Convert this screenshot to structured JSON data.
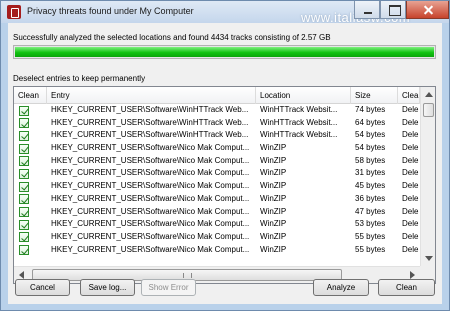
{
  "window": {
    "title": "Privacy threats found under My Computer",
    "watermark": "www.italiasw.com"
  },
  "summary": "Successfully analyzed the selected locations and found 4434 tracks consisting of 2.57 GB",
  "progress": {
    "value": 1.0,
    "color": "#12c312"
  },
  "deselect_label": "Deselect entries to keep permanently",
  "table": {
    "columns": [
      "Clean",
      "Entry",
      "Location",
      "Size",
      "Clea"
    ],
    "rows": [
      {
        "checked": true,
        "entry": "HKEY_CURRENT_USER\\Software\\WinHTTrack Web...",
        "location": "WinHTTrack Websit...",
        "size": "74 bytes",
        "action": "Dele"
      },
      {
        "checked": true,
        "entry": "HKEY_CURRENT_USER\\Software\\WinHTTrack Web...",
        "location": "WinHTTrack Websit...",
        "size": "64 bytes",
        "action": "Dele"
      },
      {
        "checked": true,
        "entry": "HKEY_CURRENT_USER\\Software\\WinHTTrack Web...",
        "location": "WinHTTrack Websit...",
        "size": "54 bytes",
        "action": "Dele"
      },
      {
        "checked": true,
        "entry": "HKEY_CURRENT_USER\\Software\\Nico Mak Comput...",
        "location": "WinZIP",
        "size": "54 bytes",
        "action": "Dele"
      },
      {
        "checked": true,
        "entry": "HKEY_CURRENT_USER\\Software\\Nico Mak Comput...",
        "location": "WinZIP",
        "size": "58 bytes",
        "action": "Dele"
      },
      {
        "checked": true,
        "entry": "HKEY_CURRENT_USER\\Software\\Nico Mak Comput...",
        "location": "WinZIP",
        "size": "31 bytes",
        "action": "Dele"
      },
      {
        "checked": true,
        "entry": "HKEY_CURRENT_USER\\Software\\Nico Mak Comput...",
        "location": "WinZIP",
        "size": "45 bytes",
        "action": "Dele"
      },
      {
        "checked": true,
        "entry": "HKEY_CURRENT_USER\\Software\\Nico Mak Comput...",
        "location": "WinZIP",
        "size": "36 bytes",
        "action": "Dele"
      },
      {
        "checked": true,
        "entry": "HKEY_CURRENT_USER\\Software\\Nico Mak Comput...",
        "location": "WinZIP",
        "size": "47 bytes",
        "action": "Dele"
      },
      {
        "checked": true,
        "entry": "HKEY_CURRENT_USER\\Software\\Nico Mak Comput...",
        "location": "WinZIP",
        "size": "53 bytes",
        "action": "Dele"
      },
      {
        "checked": true,
        "entry": "HKEY_CURRENT_USER\\Software\\Nico Mak Comput...",
        "location": "WinZIP",
        "size": "55 bytes",
        "action": "Dele"
      },
      {
        "checked": true,
        "entry": "HKEY_CURRENT_USER\\Software\\Nico Mak Comput...",
        "location": "WinZIP",
        "size": "55 bytes",
        "action": "Dele"
      }
    ]
  },
  "buttons": {
    "cancel": "Cancel",
    "save_log": "Save log...",
    "show_error": "Show Error",
    "analyze": "Analyze",
    "clean": "Clean"
  }
}
